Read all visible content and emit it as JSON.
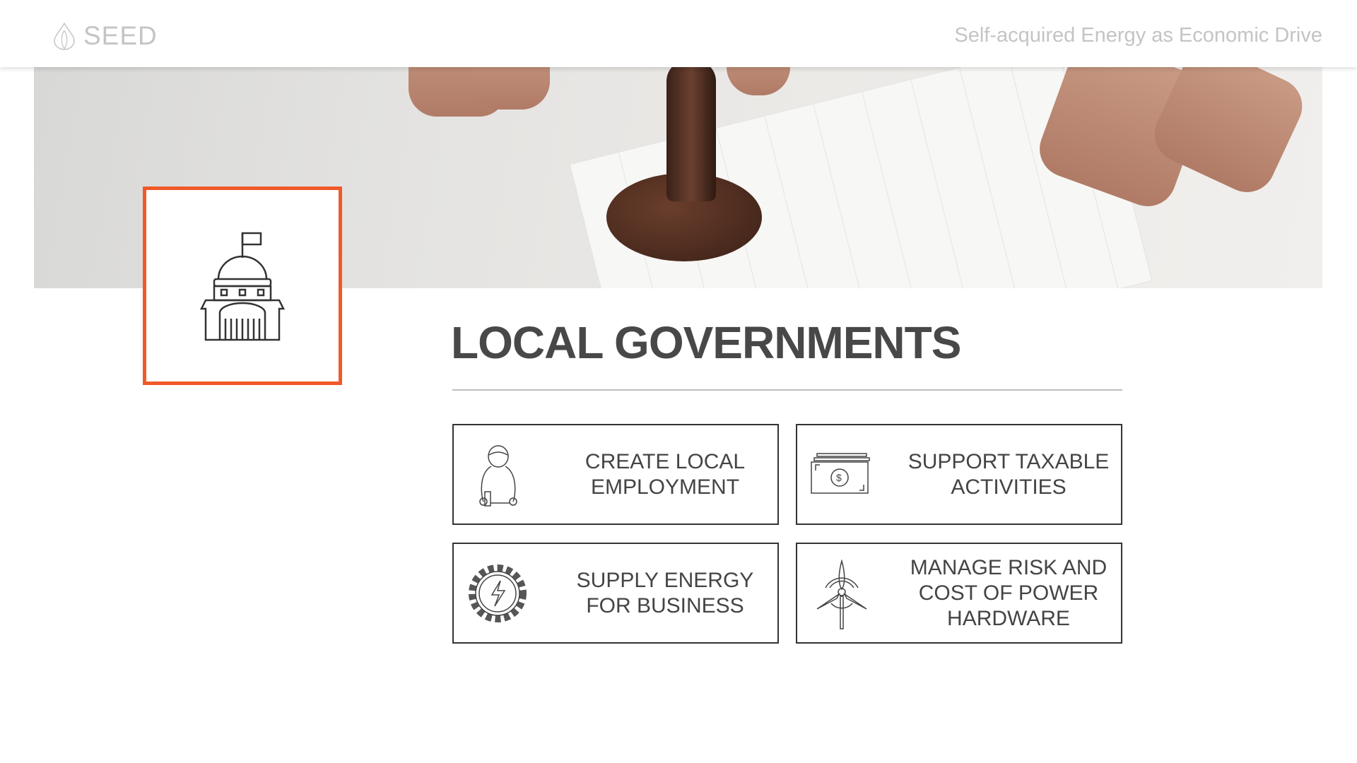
{
  "header": {
    "logo_text": "SEED",
    "logo_icon": "seed-drop-icon",
    "tagline": "Self-acquired Energy as Economic Drive"
  },
  "hero": {
    "badge_icon": "government-building-icon"
  },
  "section": {
    "title": "LOCAL GOVERNMENTS"
  },
  "cards": [
    {
      "icon": "worker-icon",
      "label": "CREATE LOCAL EMPLOYMENT"
    },
    {
      "icon": "money-icon",
      "label": "SUPPORT TAXABLE ACTIVITIES"
    },
    {
      "icon": "energy-gear-icon",
      "label": "SUPPLY ENERGY FOR BUSINESS"
    },
    {
      "icon": "wind-turbine-icon",
      "label": "MANAGE RISK AND COST OF POWER HARDWARE"
    }
  ],
  "colors": {
    "accent": "#f05a28",
    "text": "#444444",
    "header_text": "#c4c4c4"
  }
}
